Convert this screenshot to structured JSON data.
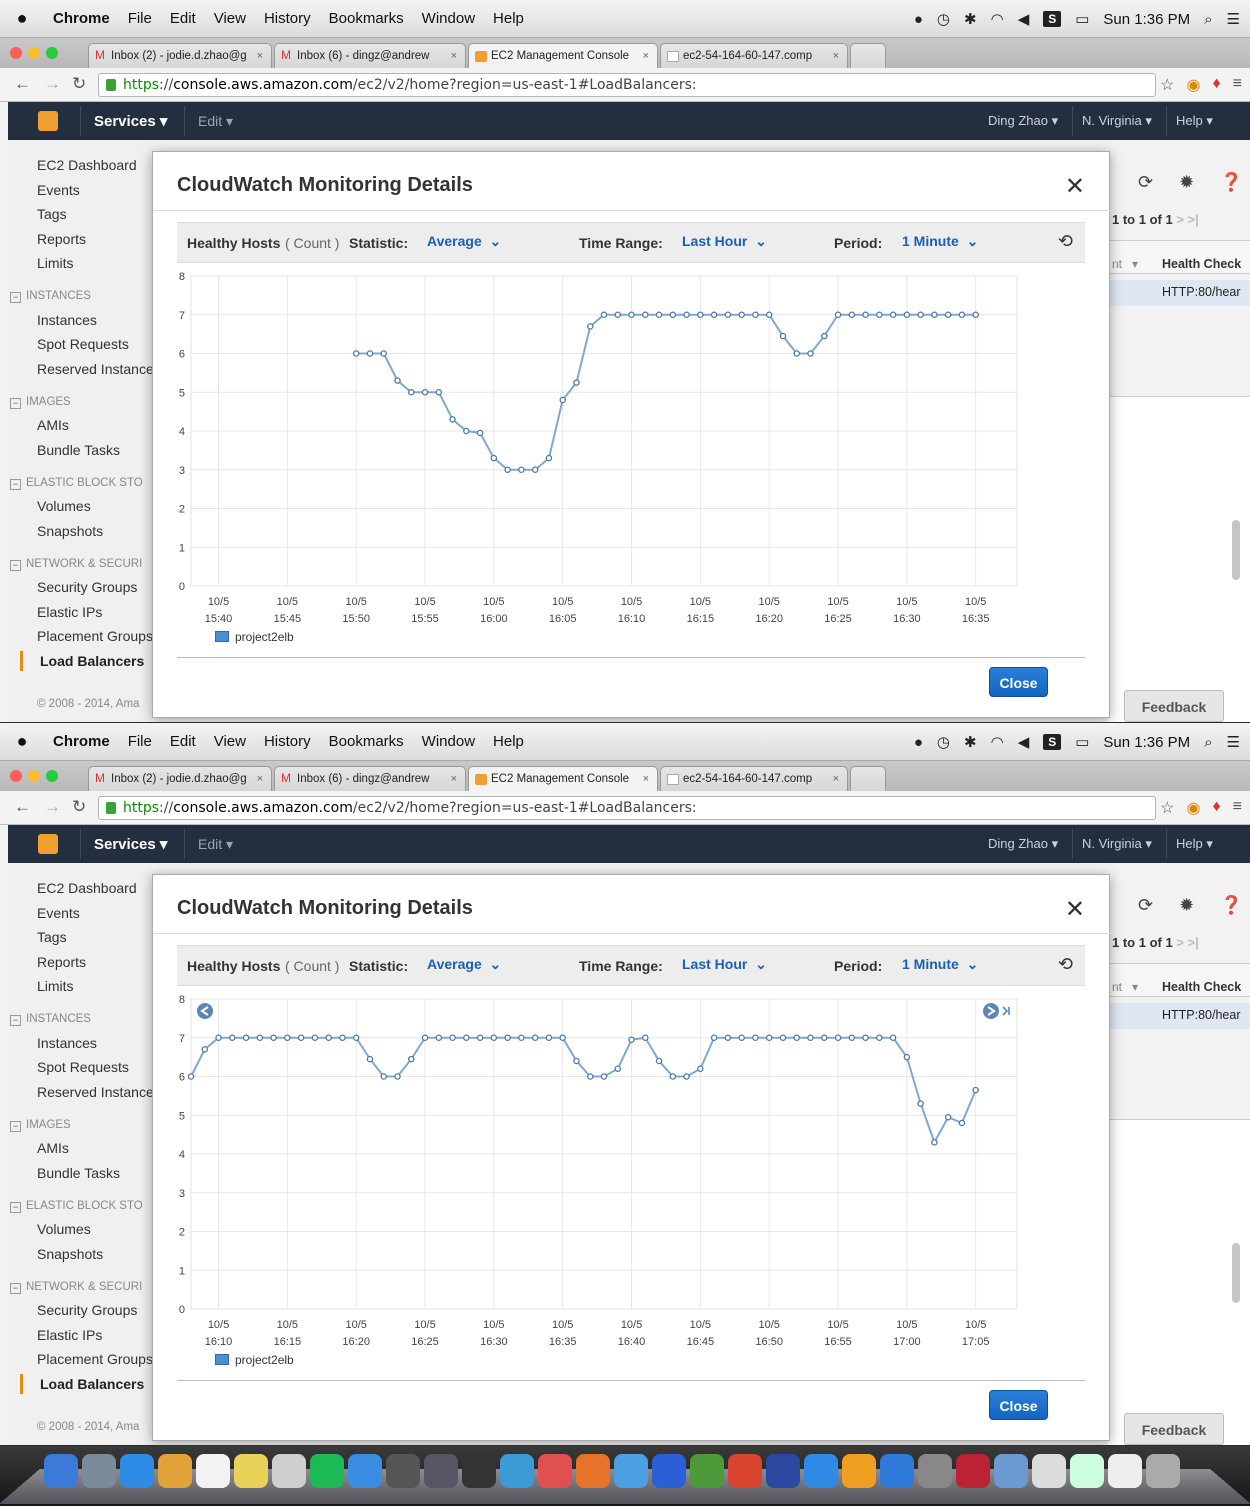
{
  "menubar": {
    "app": "Chrome",
    "items": [
      "File",
      "Edit",
      "View",
      "History",
      "Bookmarks",
      "Window",
      "Help"
    ],
    "clock": "Sun 1:36 PM"
  },
  "tabs": [
    {
      "label": "Inbox (2) - jodie.d.zhao@g"
    },
    {
      "label": "Inbox (6) - dingz@andrew"
    },
    {
      "label": "EC2 Management Console"
    },
    {
      "label": "ec2-54-164-60-147.comp"
    }
  ],
  "url": {
    "scheme": "https",
    "host": "console.aws.amazon.com",
    "path": "/ec2/v2/home?region=us-east-1#LoadBalancers:"
  },
  "aws_header": {
    "services": "Services",
    "edit": "Edit",
    "user": "Ding Zhao",
    "region": "N. Virginia",
    "help": "Help"
  },
  "sidebar": {
    "top_items": [
      "EC2 Dashboard",
      "Events",
      "Tags",
      "Reports",
      "Limits"
    ],
    "instances_header": "INSTANCES",
    "instances_items": [
      "Instances",
      "Spot Requests",
      "Reserved Instance"
    ],
    "images_header": "IMAGES",
    "images_items": [
      "AMIs",
      "Bundle Tasks"
    ],
    "ebs_header": "ELASTIC BLOCK STO",
    "ebs_items": [
      "Volumes",
      "Snapshots"
    ],
    "network_header": "NETWORK & SECURI",
    "network_items": [
      "Security Groups",
      "Elastic IPs",
      "Placement Groups"
    ],
    "active_item": "Load Balancers",
    "copyright": "© 2008 - 2014, Ama"
  },
  "right_panel": {
    "pagination": "1 to 1 of 1",
    "col_partial": "nt",
    "col_health": "Health Check",
    "cell_health": "HTTP:80/hear",
    "feedback": "Feedback"
  },
  "modal": {
    "title": "CloudWatch Monitoring Details",
    "metric_name": "Healthy Hosts",
    "metric_unit": "( Count )",
    "statistic_label": "Statistic:",
    "statistic_value": "Average",
    "time_range_label": "Time Range:",
    "time_range_value": "Last Hour",
    "period_label": "Period:",
    "period_value": "1 Minute",
    "legend": "project2elb",
    "close_button": "Close"
  },
  "colors": {
    "line": "#7fa8cf",
    "point_fill": "#ffffff",
    "point_stroke": "#4a78a8",
    "close_button": "#1a6fcf",
    "aws_header": "#232f3e"
  },
  "chart_data": [
    {
      "type": "line",
      "title": "",
      "xlabel": "",
      "ylabel": "",
      "ylim": [
        0,
        8
      ],
      "yticks": [
        0,
        1,
        2,
        3,
        4,
        5,
        6,
        7,
        8
      ],
      "x_range_minutes": [
        "15:38",
        "16:38"
      ],
      "x_tick_labels": [
        "10/5 15:40",
        "10/5 15:45",
        "10/5 15:50",
        "10/5 15:55",
        "10/5 16:00",
        "10/5 16:05",
        "10/5 16:10",
        "10/5 16:15",
        "10/5 16:20",
        "10/5 16:25",
        "10/5 16:30",
        "10/5 16:35"
      ],
      "grid": true,
      "legend": "bottom-left",
      "series": [
        {
          "name": "project2elb",
          "x": [
            "15:50",
            "15:51",
            "15:52",
            "15:53",
            "15:54",
            "15:55",
            "15:56",
            "15:57",
            "15:58",
            "15:59",
            "16:00",
            "16:01",
            "16:02",
            "16:03",
            "16:04",
            "16:05",
            "16:06",
            "16:07",
            "16:08",
            "16:09",
            "16:10",
            "16:11",
            "16:12",
            "16:13",
            "16:14",
            "16:15",
            "16:16",
            "16:17",
            "16:18",
            "16:19",
            "16:20",
            "16:21",
            "16:22",
            "16:23",
            "16:24",
            "16:25",
            "16:26",
            "16:27",
            "16:28",
            "16:29",
            "16:30",
            "16:31",
            "16:32",
            "16:33",
            "16:34",
            "16:35"
          ],
          "values": [
            6,
            6,
            6,
            5.3,
            5,
            5,
            5,
            4.3,
            4,
            3.95,
            3.3,
            3,
            3,
            3,
            3.3,
            4.8,
            5.25,
            6.7,
            7,
            7,
            7,
            7,
            7,
            7,
            7,
            7,
            7,
            7,
            7,
            7,
            7,
            6.45,
            6,
            6,
            6.45,
            7,
            7,
            7,
            7,
            7,
            7,
            7,
            7,
            7,
            7,
            7
          ]
        }
      ]
    },
    {
      "type": "line",
      "title": "",
      "xlabel": "",
      "ylabel": "",
      "ylim": [
        0,
        8
      ],
      "yticks": [
        0,
        1,
        2,
        3,
        4,
        5,
        6,
        7,
        8
      ],
      "x_range_minutes": [
        "16:08",
        "17:08"
      ],
      "x_tick_labels": [
        "10/5 16:10",
        "10/5 16:15",
        "10/5 16:20",
        "10/5 16:25",
        "10/5 16:30",
        "10/5 16:35",
        "10/5 16:40",
        "10/5 16:45",
        "10/5 16:50",
        "10/5 16:55",
        "10/5 17:00",
        "10/5 17:05"
      ],
      "grid": true,
      "legend": "bottom-left",
      "series": [
        {
          "name": "project2elb",
          "x": [
            "16:08",
            "16:09",
            "16:10",
            "16:11",
            "16:12",
            "16:13",
            "16:14",
            "16:15",
            "16:16",
            "16:17",
            "16:18",
            "16:19",
            "16:20",
            "16:21",
            "16:22",
            "16:23",
            "16:24",
            "16:25",
            "16:26",
            "16:27",
            "16:28",
            "16:29",
            "16:30",
            "16:31",
            "16:32",
            "16:33",
            "16:34",
            "16:35",
            "16:36",
            "16:37",
            "16:38",
            "16:39",
            "16:40",
            "16:41",
            "16:42",
            "16:43",
            "16:44",
            "16:45",
            "16:46",
            "16:47",
            "16:48",
            "16:49",
            "16:50",
            "16:51",
            "16:52",
            "16:53",
            "16:54",
            "16:55",
            "16:56",
            "16:57",
            "16:58",
            "16:59",
            "17:00",
            "17:01",
            "17:02",
            "17:03",
            "17:04",
            "17:05"
          ],
          "values": [
            6,
            6.7,
            7,
            7,
            7,
            7,
            7,
            7,
            7,
            7,
            7,
            7,
            7,
            6.45,
            6,
            6,
            6.45,
            7,
            7,
            7,
            7,
            7,
            7,
            7,
            7,
            7,
            7,
            7,
            6.4,
            6,
            6,
            6.2,
            6.95,
            7,
            6.4,
            6,
            6,
            6.2,
            7,
            7,
            7,
            7,
            7,
            7,
            7,
            7,
            7,
            7,
            7,
            7,
            7,
            7,
            6.5,
            5.3,
            4.3,
            4.95,
            4.8,
            5.65
          ]
        }
      ]
    }
  ]
}
